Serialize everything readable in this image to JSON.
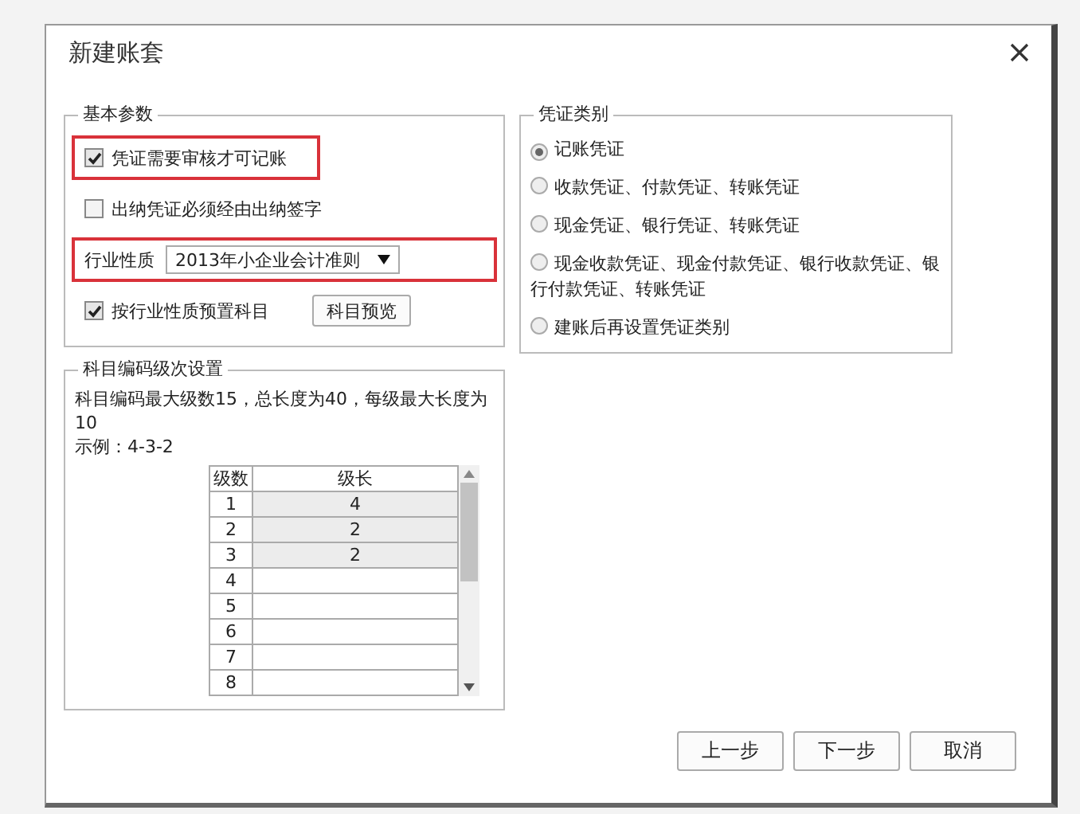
{
  "window": {
    "title": "新建账套"
  },
  "basic_params": {
    "title": "基本参数",
    "items": [
      {
        "kind": "checkbox",
        "label": "凭证需要审核才可记账",
        "checked": true,
        "highlighted": true
      },
      {
        "kind": "checkbox",
        "label": "出纳凭证必须经由出纳签字",
        "checked": false,
        "highlighted": false
      },
      {
        "kind": "select",
        "label": "行业性质",
        "value": "2013年小企业会计准则",
        "highlighted": true
      },
      {
        "kind": "checkbox_button",
        "label": "按行业性质预置科目",
        "checked": true,
        "highlighted": false,
        "button": "科目预览"
      }
    ]
  },
  "voucher_types": {
    "title": "凭证类别",
    "options": [
      {
        "label": "记账凭证",
        "selected": true
      },
      {
        "label": "收款凭证、付款凭证、转账凭证",
        "selected": false
      },
      {
        "label": "现金凭证、银行凭证、转账凭证",
        "selected": false
      },
      {
        "label": "现金收款凭证、现金付款凭证、银行收款凭证、银行付款凭证、转账凭证",
        "selected": false
      },
      {
        "label": "建账后再设置凭证类别",
        "selected": false
      }
    ]
  },
  "code_levels": {
    "title": "科目编码级次设置",
    "description": "科目编码最大级数15，总长度为40，每级最大长度为10",
    "example": "示例：4-3-2",
    "table": {
      "columns": [
        "级数",
        "级长"
      ],
      "rows": [
        {
          "level": "1",
          "length": "4"
        },
        {
          "level": "2",
          "length": "2"
        },
        {
          "level": "3",
          "length": "2"
        },
        {
          "level": "4"
        },
        {
          "level": "5"
        },
        {
          "level": "6"
        },
        {
          "level": "7"
        },
        {
          "level": "8"
        }
      ]
    }
  },
  "buttons": [
    "上一步",
    "下一步",
    "取消"
  ]
}
